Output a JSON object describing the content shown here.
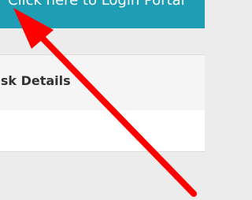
{
  "banner": {
    "link_text": "Click here to Login Portal",
    "background_color": "#1f9db4"
  },
  "section": {
    "title": "esk Details"
  },
  "annotation": {
    "icon": "red-arrow-icon",
    "color": "#ff0000"
  }
}
